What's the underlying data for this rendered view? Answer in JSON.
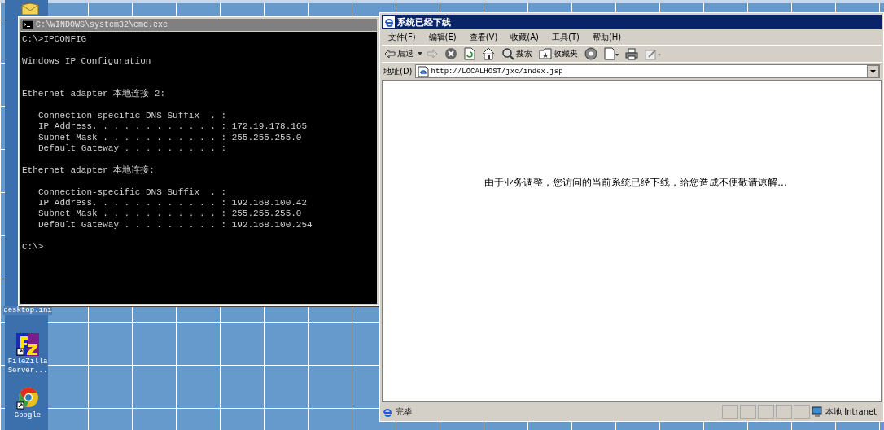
{
  "desktop": {
    "icons": [
      {
        "kind": "ini",
        "label": "desktop.ini"
      },
      {
        "kind": "filezilla",
        "label": "FileZilla Server..."
      },
      {
        "kind": "chrome",
        "label": "Google"
      }
    ]
  },
  "console": {
    "title": "C:\\WINDOWS\\system32\\cmd.exe",
    "command": "C:\\>IPCONFIG",
    "header": "Windows IP Configuration",
    "adapters": [
      {
        "name": "Ethernet adapter 本地连接 2:",
        "entries": [
          "Connection-specific DNS Suffix  . :",
          "IP Address. . . . . . . . . . . . : 172.19.178.165",
          "Subnet Mask . . . . . . . . . . . : 255.255.255.0",
          "Default Gateway . . . . . . . . . :"
        ]
      },
      {
        "name": "Ethernet adapter 本地连接:",
        "entries": [
          "Connection-specific DNS Suffix  . :",
          "IP Address. . . . . . . . . . . . : 192.168.100.42",
          "Subnet Mask . . . . . . . . . . . : 255.255.255.0",
          "Default Gateway . . . . . . . . . : 192.168.100.254"
        ]
      }
    ],
    "prompt": "C:\\>"
  },
  "browser": {
    "title": "系统已经下线",
    "menu": [
      "文件(F)",
      "编辑(E)",
      "查看(V)",
      "收藏(A)",
      "工具(T)",
      "帮助(H)"
    ],
    "toolbar": [
      {
        "kind": "back",
        "label": "后退"
      },
      {
        "kind": "forward"
      },
      {
        "kind": "stop"
      },
      {
        "kind": "refresh"
      },
      {
        "kind": "home"
      },
      {
        "kind": "search",
        "label": "搜索"
      },
      {
        "kind": "favorites",
        "label": "收藏夹"
      },
      {
        "kind": "media"
      },
      {
        "kind": "history"
      },
      {
        "kind": "print"
      },
      {
        "kind": "edit"
      }
    ],
    "address_label": "地址(D)",
    "address": "http://LOCALHOST/jxc/index.jsp",
    "message": "由于业务调整，您访问的当前系统已经下线，给您造成不便敬请谅解...",
    "status": "完毕",
    "zone": "本地 Intranet"
  }
}
